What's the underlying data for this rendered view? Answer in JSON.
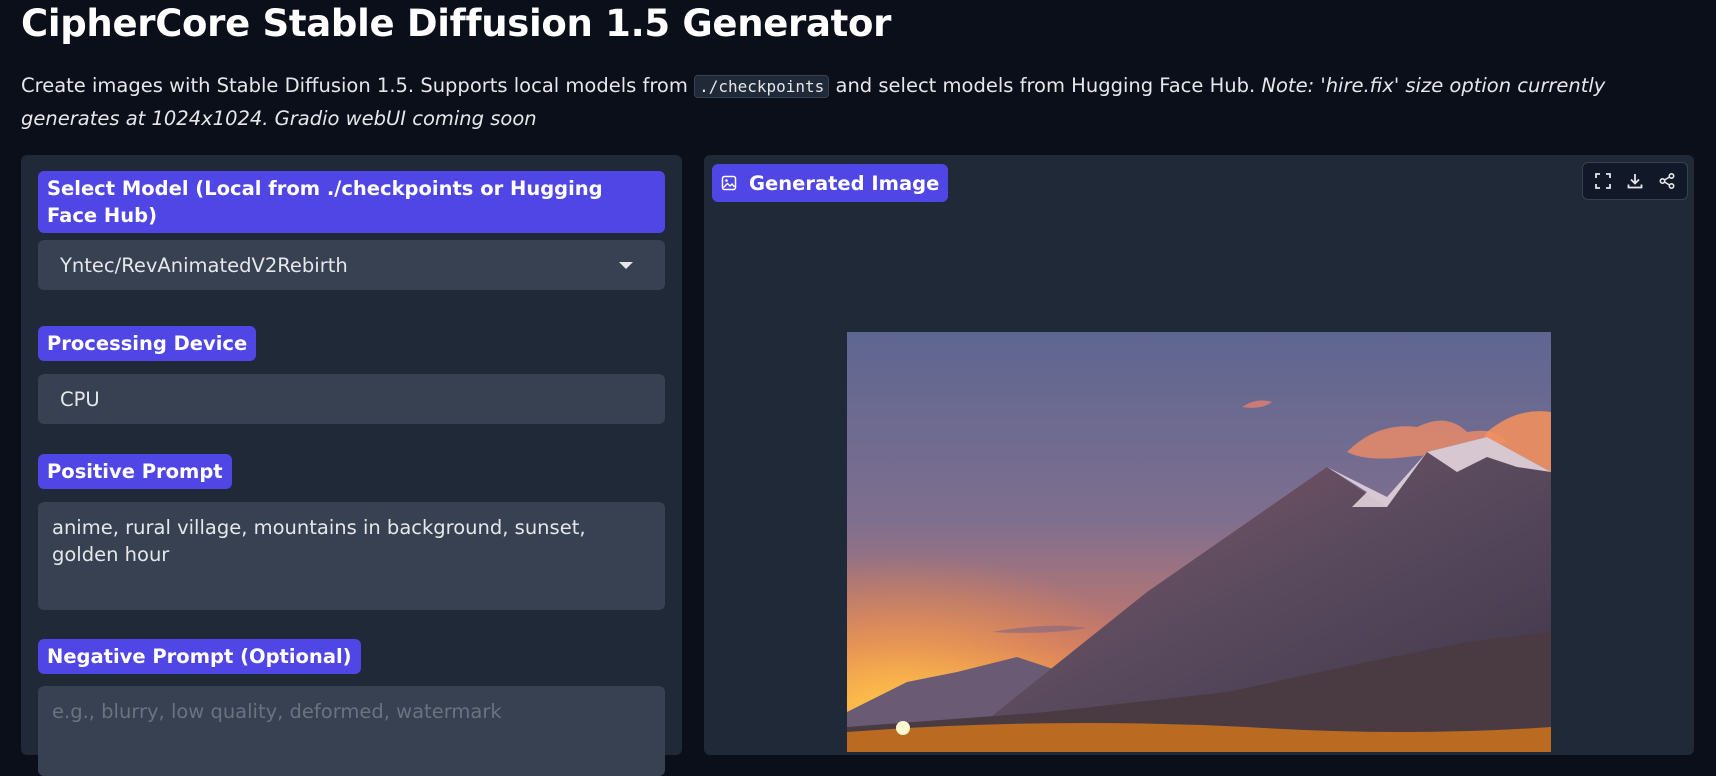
{
  "header": {
    "title": "CipherCore Stable Diffusion 1.5 Generator",
    "desc_pre": "Create images with Stable Diffusion 1.5. Supports local models from ",
    "desc_code": "./checkpoints",
    "desc_mid": " and select models from Hugging Face Hub. ",
    "desc_note": "Note: 'hire.fix' size option currently generates at 1024x1024. Gradio webUI coming soon"
  },
  "form": {
    "model_label": "Select Model (Local from ./checkpoints or Hugging Face Hub)",
    "model_value": "Yntec/RevAnimatedV2Rebirth",
    "device_label": "Processing Device",
    "device_value": "CPU",
    "positive_label": "Positive Prompt",
    "positive_value": "anime, rural village, mountains in background, sunset, golden hour",
    "negative_label": "Negative Prompt (Optional)",
    "negative_placeholder": "e.g., blurry, low quality, deformed, watermark",
    "negative_value": ""
  },
  "output": {
    "label": "Generated Image",
    "label_icon": "image-icon",
    "toolbar_icons": [
      "fullscreen-icon",
      "download-icon",
      "share-icon"
    ]
  },
  "colors": {
    "background": "#0b0f19",
    "panel": "#1f2937",
    "field": "#374151",
    "accent": "#4f46e5"
  }
}
